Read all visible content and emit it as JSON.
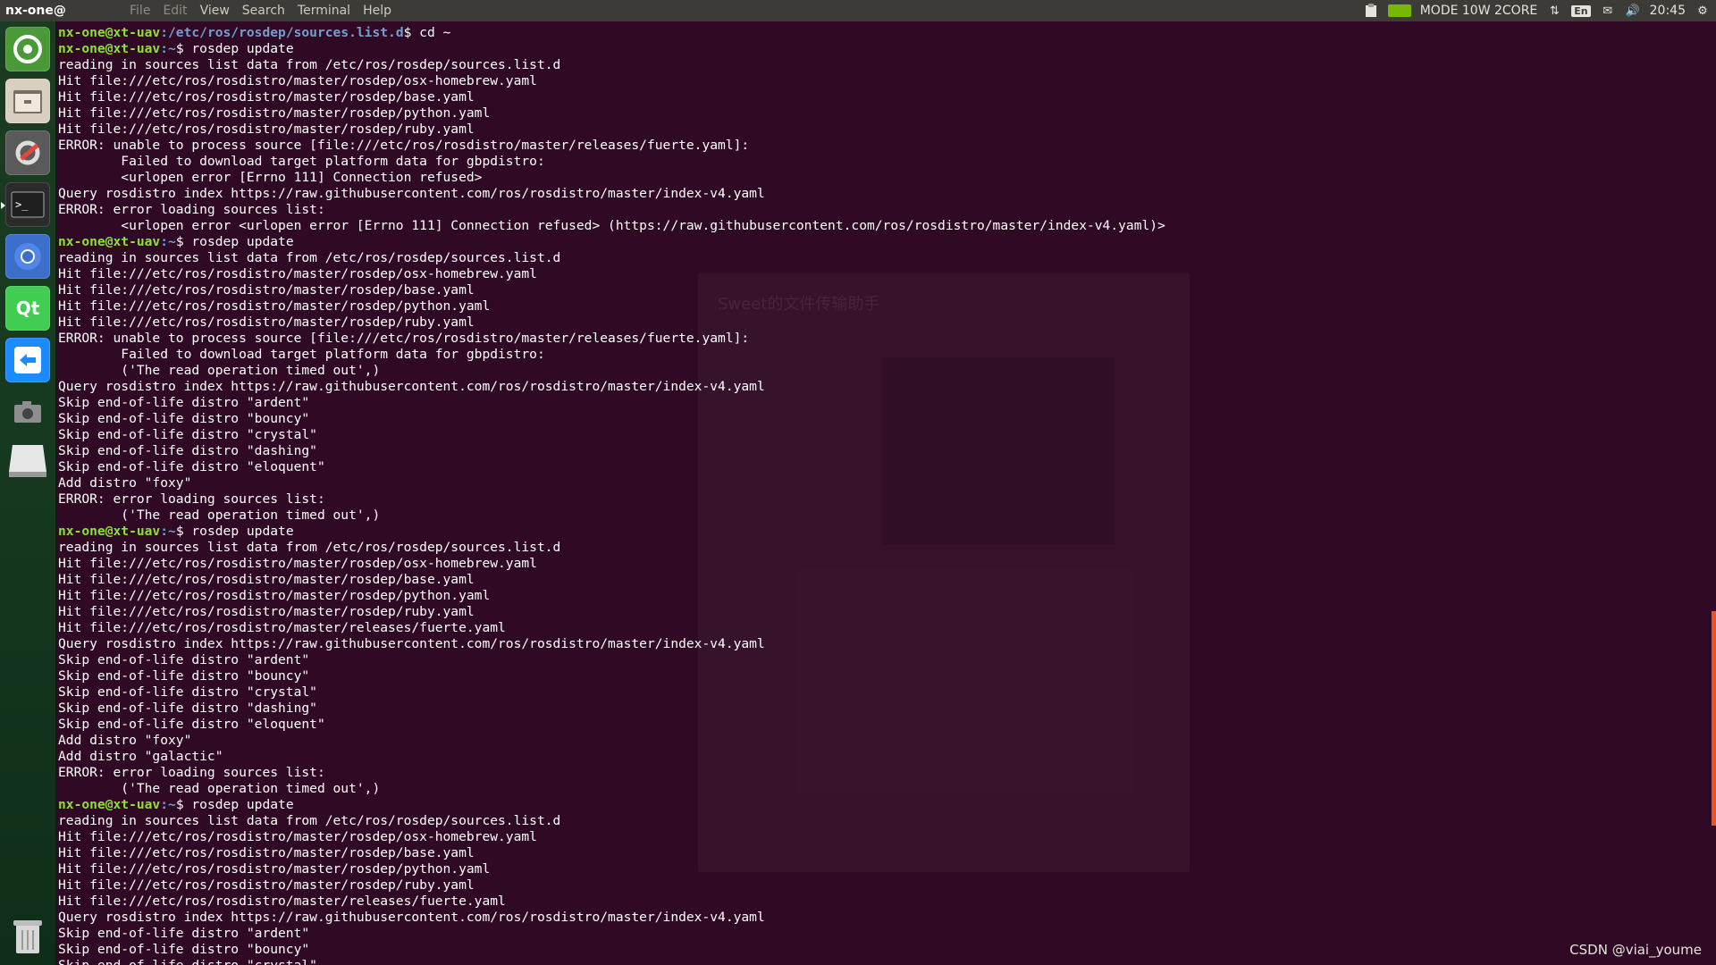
{
  "topbar": {
    "app_title": "nx-one@",
    "menu": [
      "File",
      "Edit",
      "View",
      "Search",
      "Terminal",
      "Help"
    ],
    "tray": {
      "power_mode": "MODE 10W 2CORE",
      "keyboard": "En",
      "clock": "20:45"
    }
  },
  "launcher": {
    "items": [
      "ubuntu-software-icon",
      "file-manager-icon",
      "system-settings-icon",
      "terminal-icon",
      "chromium-icon",
      "qt-creator-icon",
      "teamviewer-icon",
      "screenshot-icon",
      "drive-icon",
      "trash-icon"
    ]
  },
  "terminal": {
    "prompt_user": "nx-one@xt-uav",
    "lines": [
      {
        "t": "prompt",
        "path": ":/etc/ros/rosdep/sources.list.d",
        "cmd": "$ cd ~"
      },
      {
        "t": "prompt",
        "path": ":~",
        "cmd": "$ rosdep update"
      },
      {
        "t": "text",
        "v": "reading in sources list data from /etc/ros/rosdep/sources.list.d"
      },
      {
        "t": "text",
        "v": "Hit file:///etc/ros/rosdistro/master/rosdep/osx-homebrew.yaml"
      },
      {
        "t": "text",
        "v": "Hit file:///etc/ros/rosdistro/master/rosdep/base.yaml"
      },
      {
        "t": "text",
        "v": "Hit file:///etc/ros/rosdistro/master/rosdep/python.yaml"
      },
      {
        "t": "text",
        "v": "Hit file:///etc/ros/rosdistro/master/rosdep/ruby.yaml"
      },
      {
        "t": "text",
        "v": "ERROR: unable to process source [file:///etc/ros/rosdistro/master/releases/fuerte.yaml]:"
      },
      {
        "t": "text",
        "v": "        Failed to download target platform data for gbpdistro:"
      },
      {
        "t": "text",
        "v": "        <urlopen error [Errno 111] Connection refused>"
      },
      {
        "t": "text",
        "v": "Query rosdistro index https://raw.githubusercontent.com/ros/rosdistro/master/index-v4.yaml"
      },
      {
        "t": "text",
        "v": "ERROR: error loading sources list:"
      },
      {
        "t": "text",
        "v": "        <urlopen error <urlopen error [Errno 111] Connection refused> (https://raw.githubusercontent.com/ros/rosdistro/master/index-v4.yaml)>"
      },
      {
        "t": "prompt",
        "path": ":~",
        "cmd": "$ rosdep update"
      },
      {
        "t": "text",
        "v": "reading in sources list data from /etc/ros/rosdep/sources.list.d"
      },
      {
        "t": "text",
        "v": "Hit file:///etc/ros/rosdistro/master/rosdep/osx-homebrew.yaml"
      },
      {
        "t": "text",
        "v": "Hit file:///etc/ros/rosdistro/master/rosdep/base.yaml"
      },
      {
        "t": "text",
        "v": "Hit file:///etc/ros/rosdistro/master/rosdep/python.yaml"
      },
      {
        "t": "text",
        "v": "Hit file:///etc/ros/rosdistro/master/rosdep/ruby.yaml"
      },
      {
        "t": "text",
        "v": "ERROR: unable to process source [file:///etc/ros/rosdistro/master/releases/fuerte.yaml]:"
      },
      {
        "t": "text",
        "v": "        Failed to download target platform data for gbpdistro:"
      },
      {
        "t": "text",
        "v": "        ('The read operation timed out',)"
      },
      {
        "t": "text",
        "v": "Query rosdistro index https://raw.githubusercontent.com/ros/rosdistro/master/index-v4.yaml"
      },
      {
        "t": "text",
        "v": "Skip end-of-life distro \"ardent\""
      },
      {
        "t": "text",
        "v": "Skip end-of-life distro \"bouncy\""
      },
      {
        "t": "text",
        "v": "Skip end-of-life distro \"crystal\""
      },
      {
        "t": "text",
        "v": "Skip end-of-life distro \"dashing\""
      },
      {
        "t": "text",
        "v": "Skip end-of-life distro \"eloquent\""
      },
      {
        "t": "text",
        "v": "Add distro \"foxy\""
      },
      {
        "t": "text",
        "v": "ERROR: error loading sources list:"
      },
      {
        "t": "text",
        "v": "        ('The read operation timed out',)"
      },
      {
        "t": "prompt",
        "path": ":~",
        "cmd": "$ rosdep update"
      },
      {
        "t": "text",
        "v": "reading in sources list data from /etc/ros/rosdep/sources.list.d"
      },
      {
        "t": "text",
        "v": "Hit file:///etc/ros/rosdistro/master/rosdep/osx-homebrew.yaml"
      },
      {
        "t": "text",
        "v": "Hit file:///etc/ros/rosdistro/master/rosdep/base.yaml"
      },
      {
        "t": "text",
        "v": "Hit file:///etc/ros/rosdistro/master/rosdep/python.yaml"
      },
      {
        "t": "text",
        "v": "Hit file:///etc/ros/rosdistro/master/rosdep/ruby.yaml"
      },
      {
        "t": "text",
        "v": "Hit file:///etc/ros/rosdistro/master/releases/fuerte.yaml"
      },
      {
        "t": "text",
        "v": "Query rosdistro index https://raw.githubusercontent.com/ros/rosdistro/master/index-v4.yaml"
      },
      {
        "t": "text",
        "v": "Skip end-of-life distro \"ardent\""
      },
      {
        "t": "text",
        "v": "Skip end-of-life distro \"bouncy\""
      },
      {
        "t": "text",
        "v": "Skip end-of-life distro \"crystal\""
      },
      {
        "t": "text",
        "v": "Skip end-of-life distro \"dashing\""
      },
      {
        "t": "text",
        "v": "Skip end-of-life distro \"eloquent\""
      },
      {
        "t": "text",
        "v": "Add distro \"foxy\""
      },
      {
        "t": "text",
        "v": "Add distro \"galactic\""
      },
      {
        "t": "text",
        "v": "ERROR: error loading sources list:"
      },
      {
        "t": "text",
        "v": "        ('The read operation timed out',)"
      },
      {
        "t": "prompt",
        "path": ":~",
        "cmd": "$ rosdep update"
      },
      {
        "t": "text",
        "v": "reading in sources list data from /etc/ros/rosdep/sources.list.d"
      },
      {
        "t": "text",
        "v": "Hit file:///etc/ros/rosdistro/master/rosdep/osx-homebrew.yaml"
      },
      {
        "t": "text",
        "v": "Hit file:///etc/ros/rosdistro/master/rosdep/base.yaml"
      },
      {
        "t": "text",
        "v": "Hit file:///etc/ros/rosdistro/master/rosdep/python.yaml"
      },
      {
        "t": "text",
        "v": "Hit file:///etc/ros/rosdistro/master/rosdep/ruby.yaml"
      },
      {
        "t": "text",
        "v": "Hit file:///etc/ros/rosdistro/master/releases/fuerte.yaml"
      },
      {
        "t": "text",
        "v": "Query rosdistro index https://raw.githubusercontent.com/ros/rosdistro/master/index-v4.yaml"
      },
      {
        "t": "text",
        "v": "Skip end-of-life distro \"ardent\""
      },
      {
        "t": "text",
        "v": "Skip end-of-life distro \"bouncy\""
      },
      {
        "t": "text",
        "v": "Skip end-of-life distro \"crystal\""
      }
    ]
  },
  "ghost_dialog": {
    "title": "Sweet的文件传输助手"
  },
  "watermark": "CSDN @viai_youme",
  "colors": {
    "terminal_bg": "#300a24",
    "prompt_user": "#8ae234",
    "prompt_path": "#729fcf",
    "panel": "#3c3b37",
    "accent": "#e95420"
  }
}
